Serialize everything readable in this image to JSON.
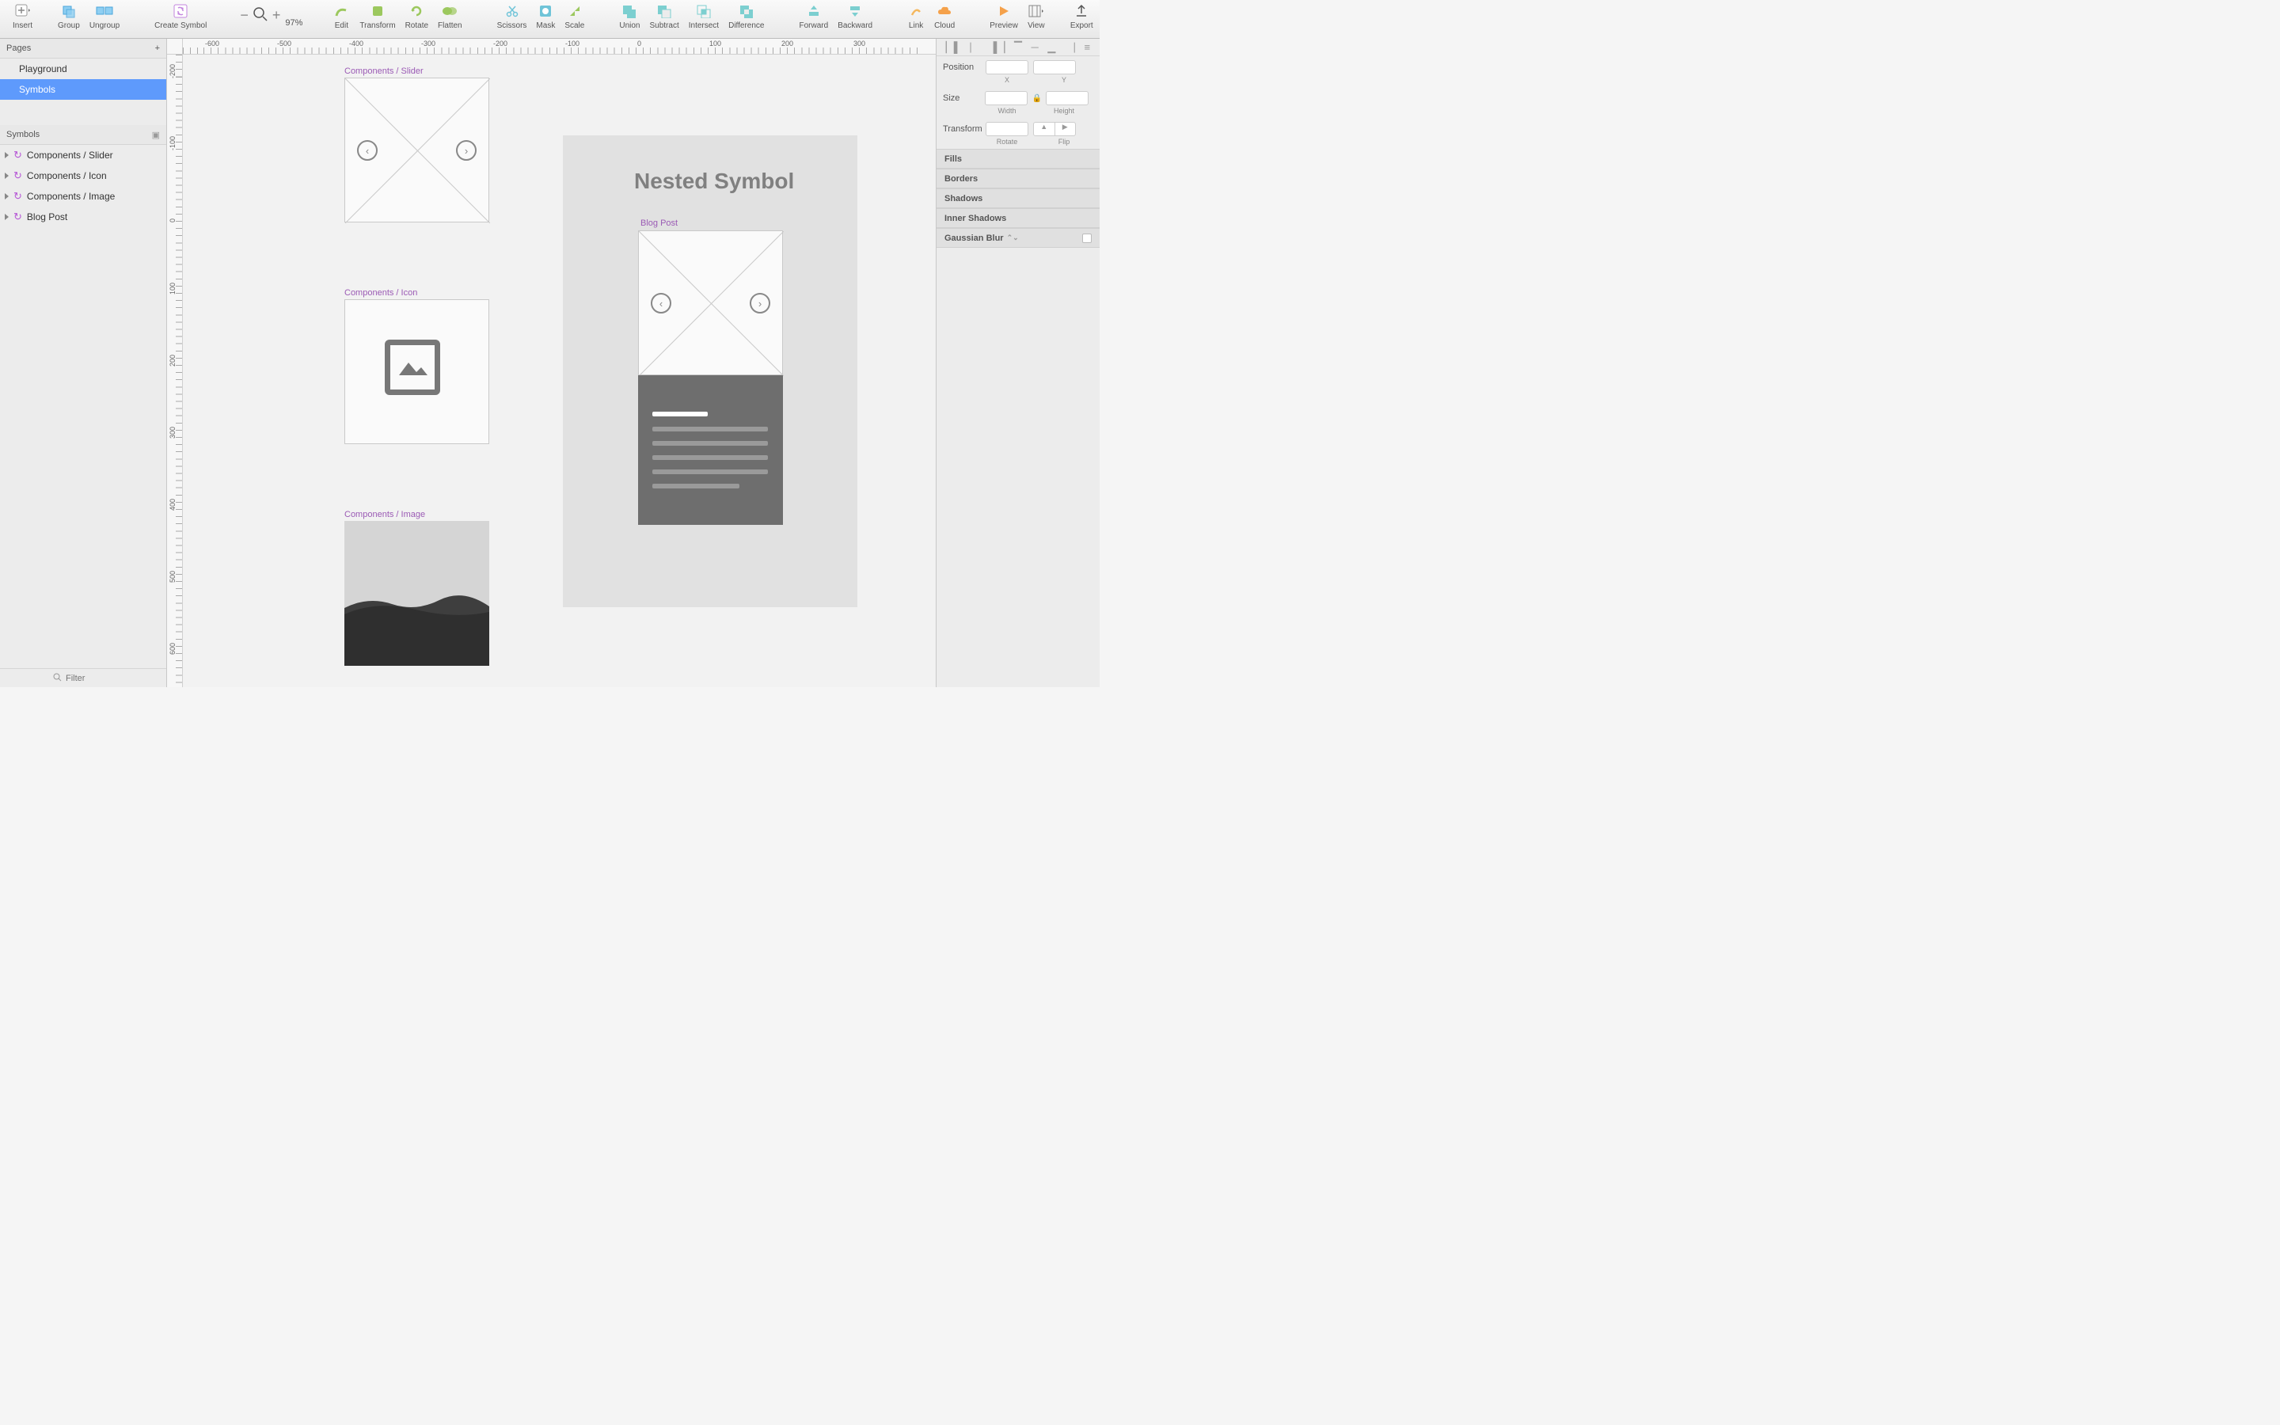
{
  "toolbar": {
    "insert": "Insert",
    "group": "Group",
    "ungroup": "Ungroup",
    "create_symbol": "Create Symbol",
    "zoom": "97%",
    "edit": "Edit",
    "transform": "Transform",
    "rotate": "Rotate",
    "flatten": "Flatten",
    "scissors": "Scissors",
    "mask": "Mask",
    "scale": "Scale",
    "union": "Union",
    "subtract": "Subtract",
    "intersect": "Intersect",
    "difference": "Difference",
    "forward": "Forward",
    "backward": "Backward",
    "link": "Link",
    "cloud": "Cloud",
    "preview": "Preview",
    "view": "View",
    "export": "Export"
  },
  "left": {
    "pages_header": "Pages",
    "pages": [
      "Playground",
      "Symbols"
    ],
    "selected_page": 1,
    "symbols_header": "Symbols",
    "layers": [
      "Components / Slider",
      "Components / Icon",
      "Components / Image",
      "Blog Post"
    ],
    "filter_placeholder": "Filter"
  },
  "canvas": {
    "ruler_h": [
      "-600",
      "-500",
      "-400",
      "-300",
      "-200",
      "-100",
      "0",
      "100",
      "200",
      "300"
    ],
    "ruler_v": [
      "-200",
      "-100",
      "0",
      "100",
      "200",
      "300",
      "400",
      "500",
      "600"
    ],
    "labels": {
      "slider": "Components / Slider",
      "icon": "Components / Icon",
      "image": "Components / Image",
      "blog": "Blog Post"
    },
    "title": "Nested Symbol"
  },
  "inspector": {
    "position": "Position",
    "x": "X",
    "y": "Y",
    "size": "Size",
    "width": "Width",
    "height": "Height",
    "transform": "Transform",
    "rotate": "Rotate",
    "flip": "Flip",
    "sections": [
      "Fills",
      "Borders",
      "Shadows",
      "Inner Shadows",
      "Gaussian Blur"
    ]
  }
}
